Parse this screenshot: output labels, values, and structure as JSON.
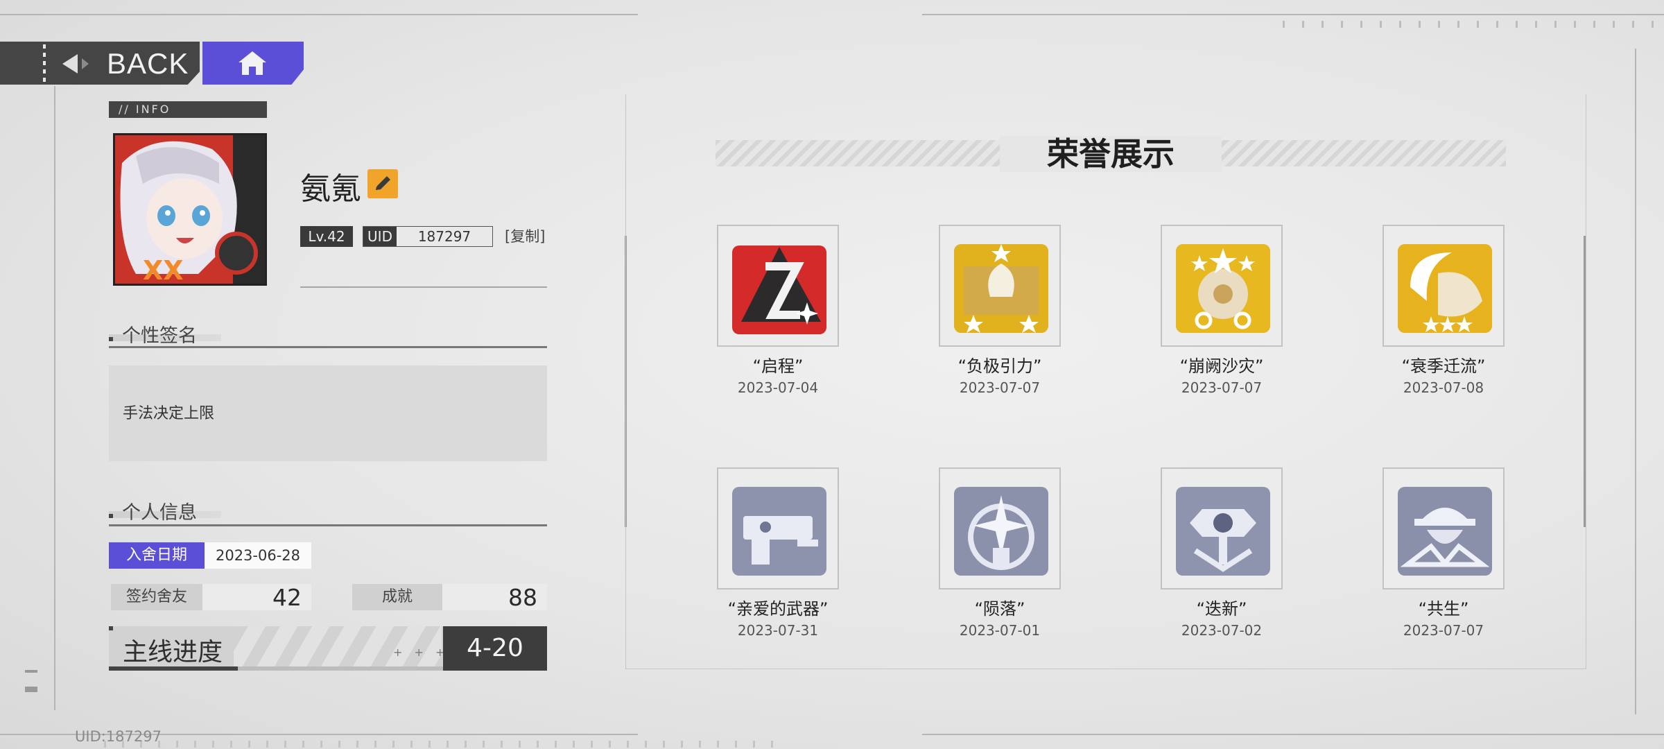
{
  "nav": {
    "back_label": "BACK"
  },
  "profile": {
    "info_tag": "// INFO",
    "name": "氨氪",
    "level": "Lv.42",
    "uid_label": "UID",
    "uid_value": "187297",
    "copy_label": "[复制]"
  },
  "signature": {
    "title": "个性签名",
    "text": "手法决定上限"
  },
  "personal": {
    "title": "个人信息",
    "join_label": "入舍日期",
    "join_date": "2023-06-28",
    "friends_label": "签约舍友",
    "friends_value": "42",
    "achievements_label": "成就",
    "achievements_value": "88",
    "progress_label": "主线进度",
    "progress_plus": "+ + +",
    "progress_value": "4-20"
  },
  "footer": {
    "uid_text": "UID:187297"
  },
  "honors": {
    "title": "荣誉展示",
    "items": [
      {
        "name": "“启程”",
        "date": "2023-07-04",
        "tier": "red"
      },
      {
        "name": "“负极引力”",
        "date": "2023-07-07",
        "tier": "gold"
      },
      {
        "name": "“崩阙沙灾”",
        "date": "2023-07-07",
        "tier": "gold"
      },
      {
        "name": "“衰季迁流”",
        "date": "2023-07-08",
        "tier": "gold"
      },
      {
        "name": "“亲爱的武器”",
        "date": "2023-07-31",
        "tier": "silver"
      },
      {
        "name": "“陨落”",
        "date": "2023-07-01",
        "tier": "silver"
      },
      {
        "name": "“迭新”",
        "date": "2023-07-02",
        "tier": "silver"
      },
      {
        "name": "“共生”",
        "date": "2023-07-07",
        "tier": "silver"
      }
    ]
  },
  "colors": {
    "accent": "#5a4fd6",
    "edit": "#f0a42a",
    "dark": "#3d3d3d"
  }
}
